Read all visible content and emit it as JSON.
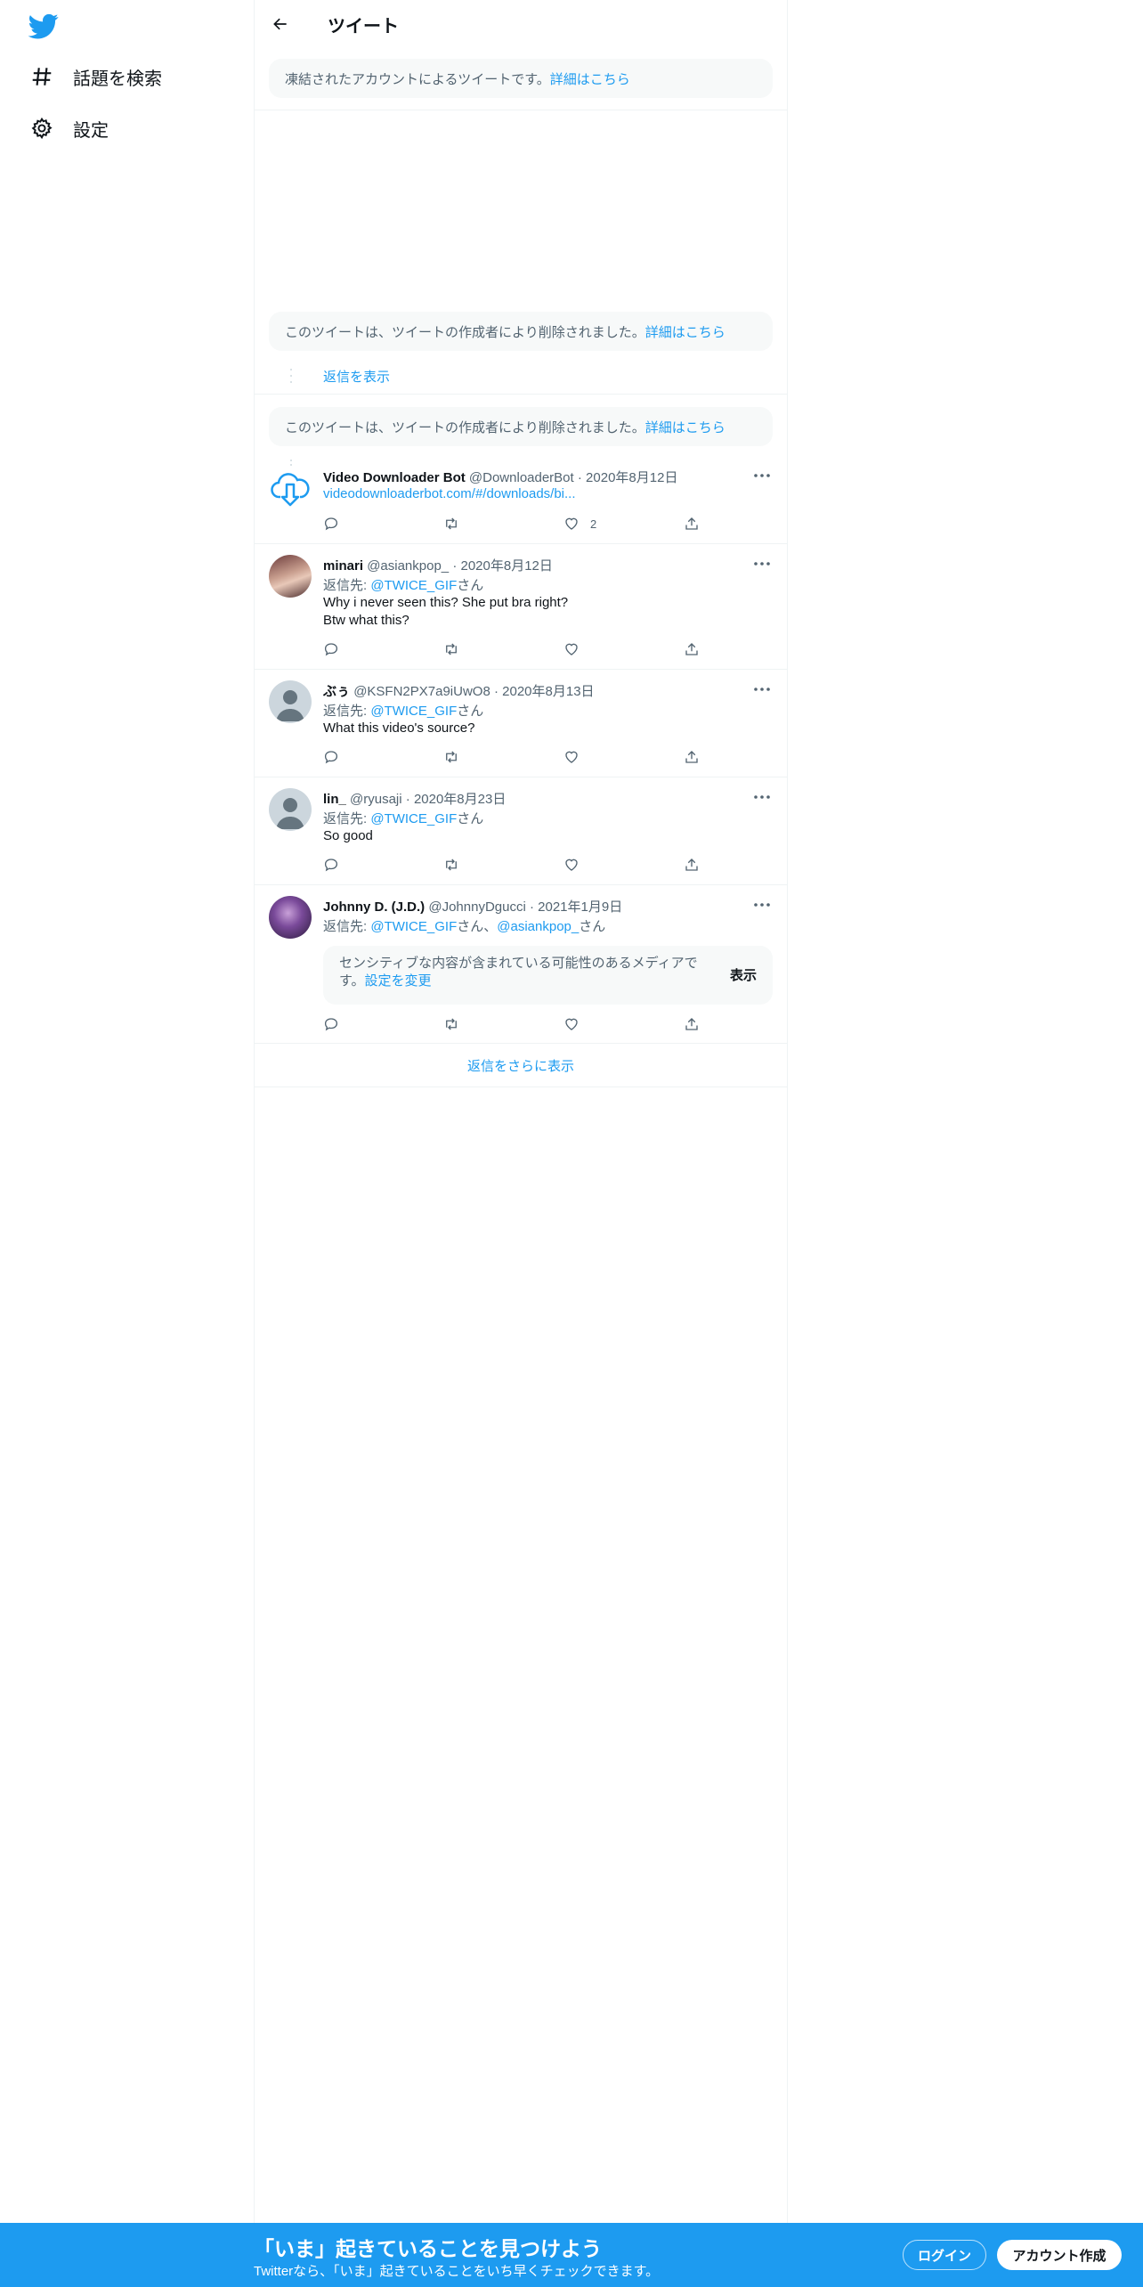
{
  "sidebar": {
    "logo_icon": "twitter-bird-icon",
    "items": [
      {
        "label": "話題を検索",
        "icon": "hashtag-icon"
      },
      {
        "label": "設定",
        "icon": "gear-icon"
      }
    ]
  },
  "header": {
    "title": "ツイート",
    "back_icon": "arrow-left-icon"
  },
  "notices": {
    "suspended": {
      "text": "凍結されたアカウントによるツイートです。",
      "link": "詳細はこちら"
    },
    "deleted_1": {
      "text": "このツイートは、ツイートの作成者により削除されました。",
      "link": "詳細はこちら"
    },
    "deleted_2": {
      "text": "このツイートは、ツイートの作成者により削除されました。",
      "link": "詳細はこちら"
    }
  },
  "show_replies": "返信を表示",
  "tweets": [
    {
      "name": "Video Downloader Bot",
      "handle": "@DownloaderBot",
      "sep": "·",
      "date": "2020年8月12日",
      "link": "videodownloaderbot.com/#/downloads/bi...",
      "likes": "2"
    },
    {
      "name": "minari",
      "handle": "@asiankpop_",
      "sep": "·",
      "date": "2020年8月12日",
      "reply_prefix": "返信先: ",
      "reply_to": "@TWICE_GIF",
      "reply_suffix": "さん",
      "text_1": "Why i never seen this? She put bra right?",
      "text_2": "Btw what this?"
    },
    {
      "name": "ぶぅ",
      "handle": "@KSFN2PX7a9iUwO8",
      "sep": "·",
      "date": "2020年8月13日",
      "reply_prefix": "返信先: ",
      "reply_to": "@TWICE_GIF",
      "reply_suffix": "さん",
      "text_1": "What this video's source?"
    },
    {
      "name": "lin_",
      "handle": "@ryusaji",
      "sep": "·",
      "date": "2020年8月23日",
      "reply_prefix": "返信先: ",
      "reply_to": "@TWICE_GIF",
      "reply_suffix": "さん",
      "text_1": "So good"
    },
    {
      "name": "Johnny D. (J.D.)",
      "handle": "@JohnnyDgucci",
      "sep": "·",
      "date": "2021年1月9日",
      "reply_prefix": "返信先: ",
      "reply_to": "@TWICE_GIF",
      "reply_mid": "さん、",
      "reply_to_2": "@asiankpop_",
      "reply_suffix": "さん",
      "sensitive_text": "センシティブな内容が含まれている可能性のあるメディアです。",
      "sensitive_link": "設定を変更",
      "sensitive_button": "表示"
    }
  ],
  "show_more": "返信をさらに表示",
  "bottom_bar": {
    "headline": "「いま」起きていることを見つけよう",
    "subtext": "Twitterなら、「いま」起きていることをいち早くチェックできます。",
    "login": "ログイン",
    "signup": "アカウント作成"
  },
  "colors": {
    "accent": "#1d9bf0",
    "muted_text": "#536471",
    "notice_bg": "#f7f9f9"
  }
}
